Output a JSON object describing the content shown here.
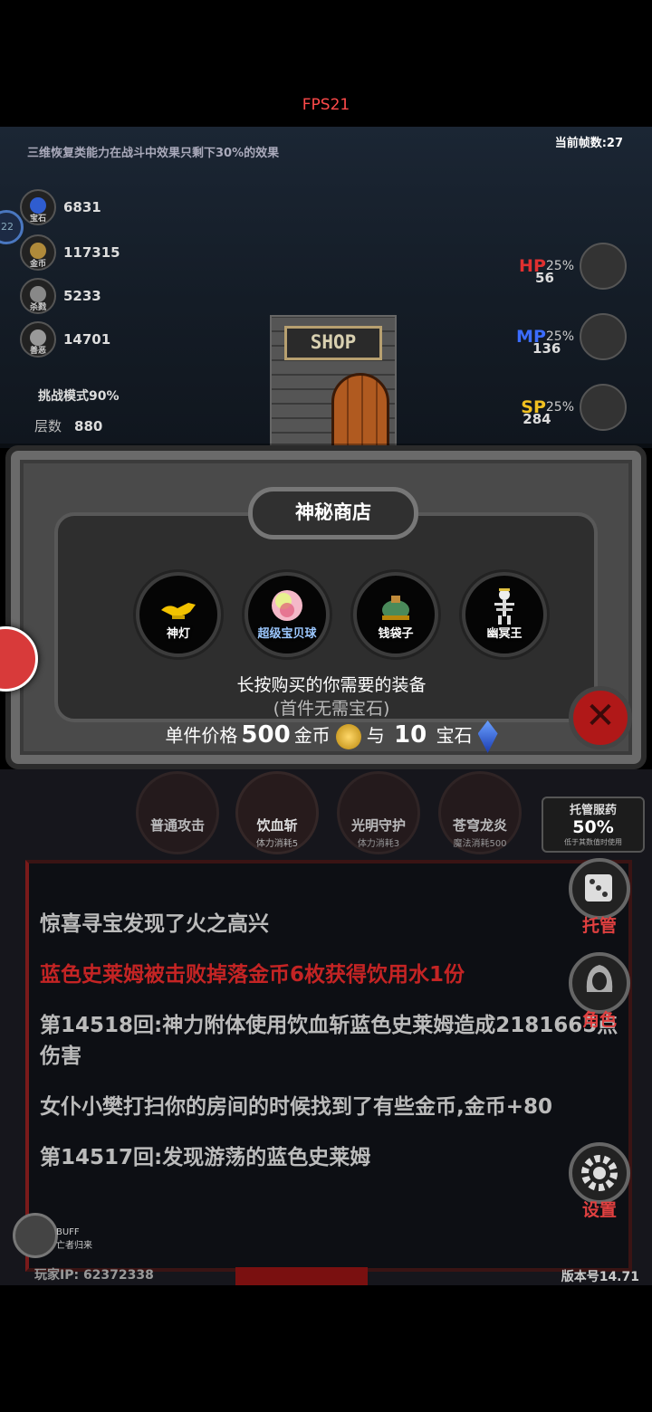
{
  "fps_label": "FPS21",
  "status": {
    "tip": "三维恢复类能力在战斗中效果只剩下30%的效果",
    "frame_count": "当前帧数:27"
  },
  "player_level": "22",
  "resources": [
    {
      "icon": "gem-icon",
      "label": "宝石",
      "value": "6831"
    },
    {
      "icon": "coin-icon",
      "label": "金币",
      "value": "117315"
    },
    {
      "icon": "skull-icon",
      "label": "杀戮",
      "value": "5233"
    },
    {
      "icon": "mask-icon",
      "label": "善恶",
      "value": "14701"
    }
  ],
  "challenge_mode": "挑战模式90%",
  "floor": {
    "label": "层数",
    "value": "880"
  },
  "stats": [
    {
      "key": "HP",
      "percent": "25%",
      "value": "56",
      "color": "#e03030"
    },
    {
      "key": "MP",
      "percent": "25%",
      "value": "136",
      "color": "#3b6cff"
    },
    {
      "key": "SP",
      "percent": "25%",
      "value": "284",
      "color": "#f0c020"
    }
  ],
  "scene": {
    "shop_sign": "SHOP"
  },
  "shop": {
    "title": "神秘商店",
    "items": [
      {
        "label": "神灯",
        "color": "#fff"
      },
      {
        "label": "超级宝贝球",
        "color": "#9cc8ff"
      },
      {
        "label": "钱袋子",
        "color": "#fff"
      },
      {
        "label": "幽冥王",
        "color": "#fff"
      }
    ],
    "hint": "长按购买的你需要的装备",
    "hint_sub": "(首件无需宝石)",
    "price_prefix": "单件价格",
    "price_gold": "500",
    "gold_unit": "金币",
    "and": "与",
    "price_gems": "10",
    "gem_unit": "宝石"
  },
  "skills": [
    {
      "name": "普通攻击",
      "cost": ""
    },
    {
      "name": "饮血斩",
      "cost": "体力消耗5"
    },
    {
      "name": "光明守护",
      "cost": "体力消耗3"
    },
    {
      "name": "苍穹龙炎",
      "cost": "魔法消耗500"
    }
  ],
  "auto_potion": {
    "title": "托管服药",
    "percent": "50%",
    "note": "低于其数值时使用"
  },
  "side_buttons": [
    {
      "label": "托管"
    },
    {
      "label": "角色"
    },
    {
      "label": "设置"
    }
  ],
  "log": [
    {
      "text": "惊喜寻宝发现了火之高兴",
      "red": false
    },
    {
      "text": "蓝色史莱姆被击败掉落金币6枚获得饮用水1份",
      "red": true
    },
    {
      "text": "第14518回:神力附体使用饮血斩蓝色史莱姆造成2181665点伤害",
      "red": false
    },
    {
      "text": "女仆小樊打扫你的房间的时候找到了有些金币,金币+80",
      "red": false
    },
    {
      "text": "第14517回:发现游荡的蓝色史莱姆",
      "red": false
    }
  ],
  "buff": {
    "title": "BUFF",
    "name": "亡者归来"
  },
  "player_id": "玩家IP: 62372338",
  "version": "版本号14.71"
}
